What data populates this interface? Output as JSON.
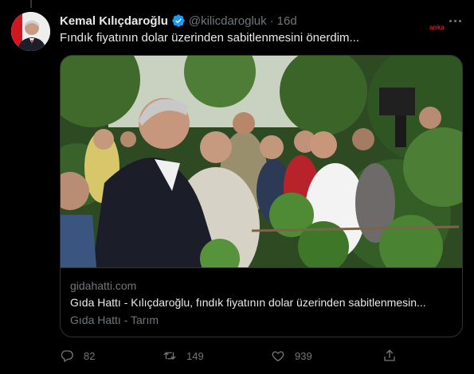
{
  "tweet": {
    "author_name": "Kemal Kılıçdaroğlu",
    "handle": "@kilicdarogluk",
    "separator": "·",
    "time": "16d",
    "text": "Fındık fiyatının dolar üzerinden sabitlenmesini önerdim...",
    "watermark": "anka"
  },
  "card": {
    "domain": "gidahatti.com",
    "title": "Gıda Hattı - Kılıçdaroğlu, fındık fiyatının dolar üzerinden sabitlenmesin...",
    "description": "Gıda Hattı - Tarım"
  },
  "actions": {
    "replies": "82",
    "retweets": "149",
    "likes": "939"
  },
  "icons": {
    "avatar": "avatar-photo",
    "verified": "verified-badge-icon",
    "more": "more-icon",
    "reply": "reply-icon",
    "retweet": "retweet-icon",
    "like": "heart-icon",
    "share": "share-icon"
  },
  "colors": {
    "background": "#000000",
    "text_primary": "#e7e9ea",
    "text_secondary": "#71767b",
    "border": "#2f3336",
    "verified": "#1d9bf0",
    "watermark": "#d21a23"
  }
}
